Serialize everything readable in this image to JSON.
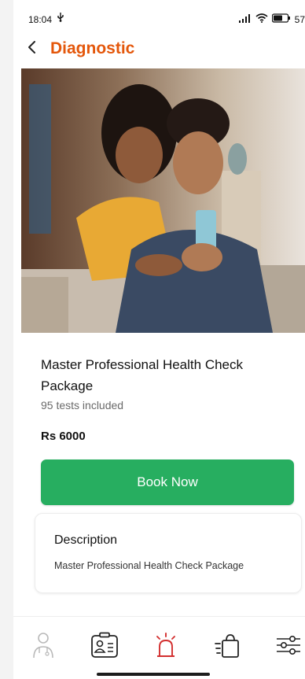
{
  "status_bar": {
    "time": "18:04",
    "extra_icon": "usb-icon",
    "battery": "57"
  },
  "header": {
    "title": "Diagnostic",
    "title_color": "#e4570b"
  },
  "package": {
    "title": "Master Professional Health Check Package",
    "tests": "95 tests included",
    "price": "Rs 6000"
  },
  "book_button": {
    "label": "Book Now",
    "color": "#27ae60"
  },
  "description": {
    "heading": "Description",
    "text": "Master Professional Health Check Package"
  },
  "bottom_nav": {
    "items": [
      {
        "icon": "doctor-icon",
        "active": false
      },
      {
        "icon": "id-card-icon",
        "active": false
      },
      {
        "icon": "emergency-alarm-icon",
        "active": true
      },
      {
        "icon": "shopping-bag-icon",
        "active": false
      },
      {
        "icon": "filter-sliders-icon",
        "active": false
      }
    ],
    "active_color": "#d32f2f"
  }
}
